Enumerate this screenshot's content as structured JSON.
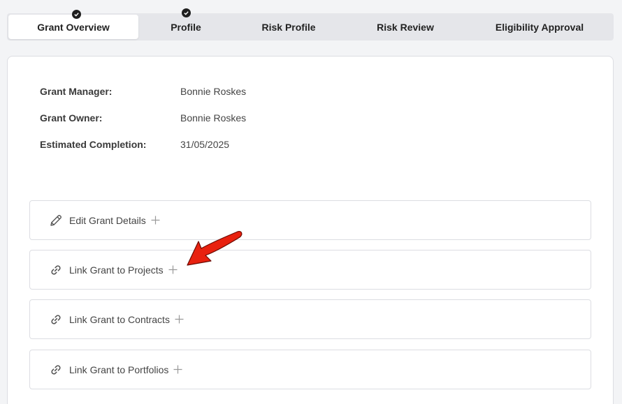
{
  "tabs": [
    {
      "label": "Grant Overview",
      "active": true,
      "completed": true
    },
    {
      "label": "Profile",
      "active": false,
      "completed": true
    },
    {
      "label": "Risk Profile",
      "active": false,
      "completed": false
    },
    {
      "label": "Risk Review",
      "active": false,
      "completed": false
    },
    {
      "label": "Eligibility Approval",
      "active": false,
      "completed": false
    }
  ],
  "details": {
    "manager_label": "Grant Manager:",
    "manager_value": "Bonnie Roskes",
    "owner_label": "Grant Owner:",
    "owner_value": "Bonnie Roskes",
    "completion_label": "Estimated Completion:",
    "completion_value": "31/05/2025"
  },
  "actions": [
    {
      "label": "Edit Grant Details",
      "icon": "pencil-icon"
    },
    {
      "label": "Link Grant to Projects",
      "icon": "link-icon"
    },
    {
      "label": "Link Grant to Contracts",
      "icon": "link-icon"
    },
    {
      "label": "Link Grant to Portfolios",
      "icon": "link-icon"
    }
  ],
  "annotation": {
    "color": "#e8210f"
  }
}
